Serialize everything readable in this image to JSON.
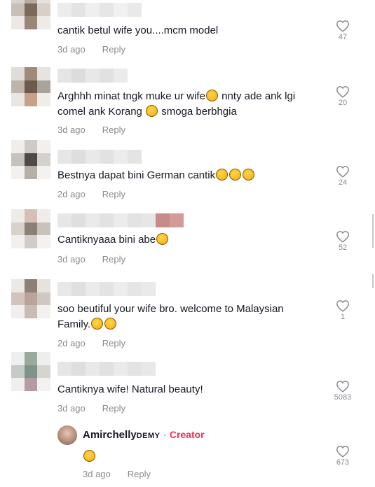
{
  "comments": [
    {
      "text": "cantik betul wife you....mcm model",
      "time": "3d ago",
      "reply": "Reply",
      "likes": "47"
    },
    {
      "text_parts": [
        "Arghhh minat tngk muke ur wife",
        " nnty ade ank lgi comel ank Korang ",
        " smoga berbhgia"
      ],
      "time": "3d ago",
      "reply": "Reply",
      "likes": "20"
    },
    {
      "text": "Bestnya dapat bini German cantik",
      "time": "2d ago",
      "reply": "Reply",
      "likes": "24"
    },
    {
      "text": "Cantiknyaaa bini abe",
      "time": "3d ago",
      "reply": "Reply",
      "likes": "52"
    },
    {
      "text": "soo beutiful your wife bro. welcome to Malaysian Family.",
      "time": "2d ago",
      "reply": "Reply",
      "likes": "1"
    },
    {
      "text": "Cantiknya wife! Natural beauty!",
      "time": "3d ago",
      "reply": "Reply",
      "likes": "5083"
    }
  ],
  "creator_reply": {
    "name_main": "Amirchelly",
    "name_small": "DEMY",
    "separator": " · ",
    "badge": "Creator",
    "time": "3d ago",
    "reply": "Reply",
    "likes": "673"
  },
  "colors": {
    "accent": "#fe2c55",
    "muted": "#8a8b91",
    "text": "#161823"
  },
  "icons": {
    "like": "heart-outline-icon",
    "emoji": "emoji-icon"
  }
}
